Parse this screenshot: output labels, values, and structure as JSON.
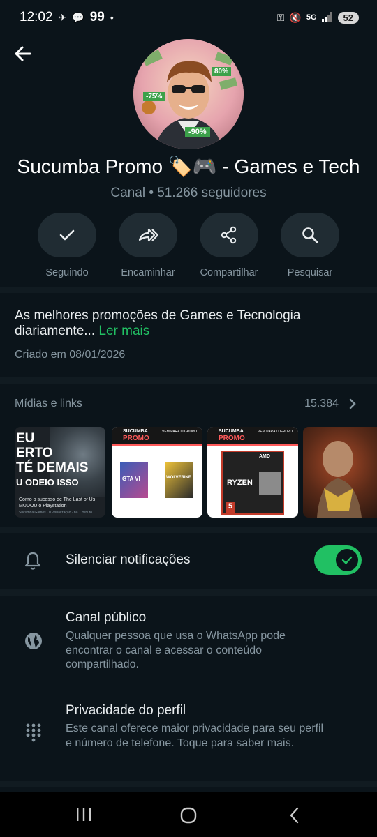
{
  "status_bar": {
    "time": "12:02",
    "chat_count": "99",
    "network": "5G",
    "battery": "52"
  },
  "channel": {
    "name": "Sucumba Promo 🏷️🎮  - Games e Tech",
    "subtitle": "Canal • 51.266 seguidores",
    "avatar_badges": [
      "80%",
      "-75%",
      "-90%"
    ]
  },
  "actions": [
    {
      "label": "Seguindo",
      "icon": "check-icon"
    },
    {
      "label": "Encaminhar",
      "icon": "forward-icon"
    },
    {
      "label": "Compartilhar",
      "icon": "share-icon"
    },
    {
      "label": "Pesquisar",
      "icon": "search-icon"
    }
  ],
  "description": {
    "text": "As melhores promoções de Games e Tecnologia diariamente...",
    "more": "Ler mais",
    "created": "Criado em 08/01/2026"
  },
  "media": {
    "title": "Mídias e links",
    "count": "15.384",
    "thumb1": {
      "headline_lines": [
        "EU",
        "ERTO",
        "TÉ DEMAIS",
        "U ODEIO ISSO"
      ],
      "caption": "Como o sucesso de The Last of Us MUDOU o Playstation",
      "meta": "Sucumba Games · 0 visualização · há 1 minuto"
    },
    "promo_brand": "SUCUMBA",
    "promo_brand2": "PROMO",
    "promo_tagline": "VEM PARA O GRUPO",
    "game1": "GTA VI",
    "game2": "WOLVERINE",
    "cpu_brand": "AMD",
    "cpu_name": "RYZEN",
    "cpu_num": "5"
  },
  "mute": {
    "label": "Silenciar notificações",
    "enabled": true
  },
  "settings": [
    {
      "title": "Canal público",
      "description": "Qualquer pessoa que usa o WhatsApp pode encontrar o canal e acessar o conteúdo compartilhado.",
      "icon": "globe-icon"
    },
    {
      "title": "Privacidade do perfil",
      "description": "Este canal oferece maior privacidade para seu perfil e número de telefone. Toque para saber mais.",
      "icon": "dialpad-icon"
    }
  ],
  "colors": {
    "background": "#0b141a",
    "accent": "#21c063",
    "button_bg": "#202c33",
    "secondary_text": "#8696a0"
  }
}
